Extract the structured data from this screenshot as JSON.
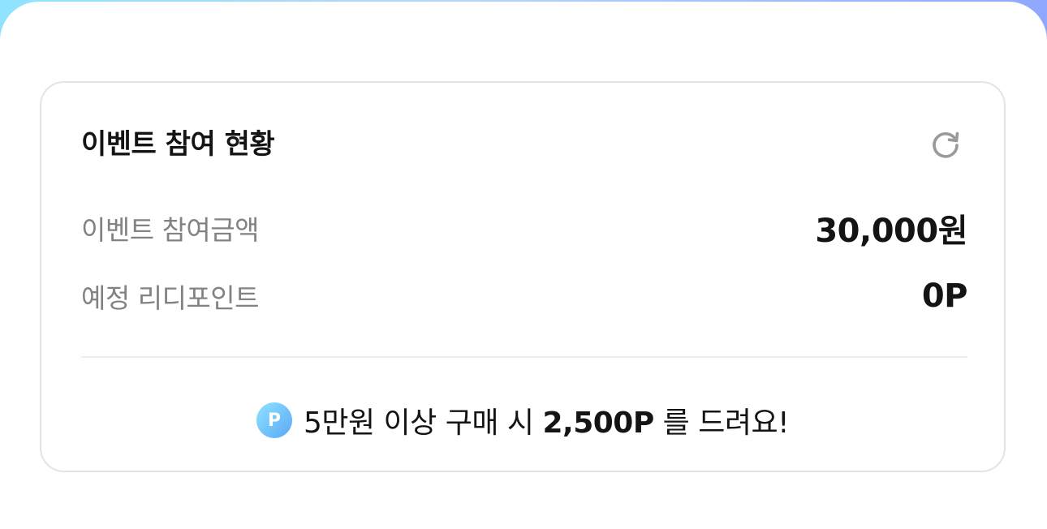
{
  "card": {
    "title": "이벤트 참여 현황",
    "refresh_icon": "refresh-icon",
    "rows": [
      {
        "label": "이벤트 참여금액",
        "value": "30,000원"
      },
      {
        "label": "예정 리디포인트",
        "value": "0P"
      }
    ]
  },
  "promo": {
    "badge_icon": "point-icon",
    "badge_text": "P",
    "text_before": "5만원 이상 구매 시 ",
    "highlight": "2,500P",
    "text_after": " 를 드려요!"
  },
  "colors": {
    "top_gradient_start": "#8fe3ff",
    "top_gradient_end": "#8fa8ff",
    "card_border": "#e4e4e6",
    "label_gray": "#828282",
    "text_dark": "#141414"
  }
}
